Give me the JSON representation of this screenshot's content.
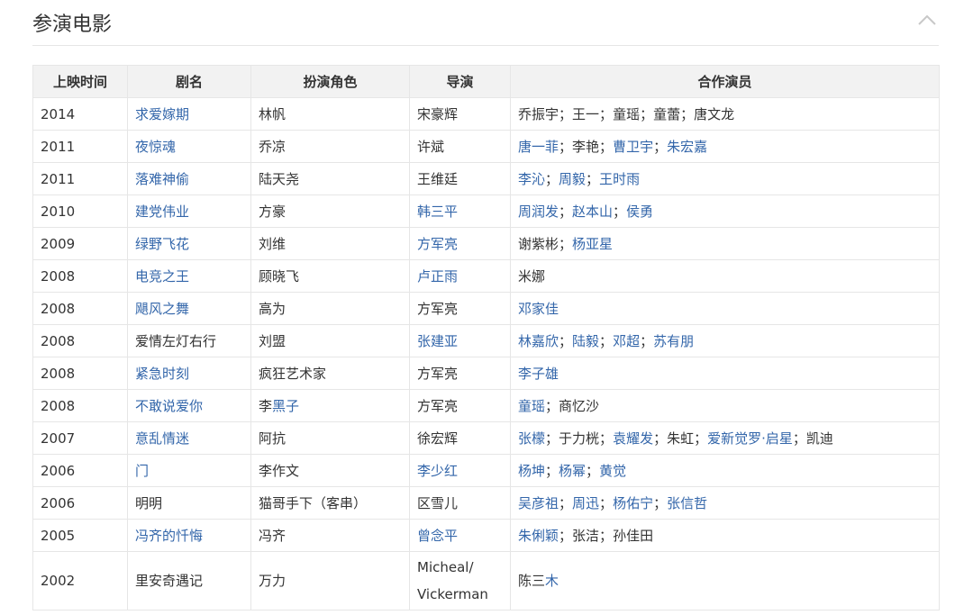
{
  "section": {
    "title": "参演电影",
    "collapse_icon": "chevron-up-icon"
  },
  "colors": {
    "link": "#3366aa",
    "header_bg": "#f2f2f2",
    "border": "#e6e6e6"
  },
  "table": {
    "headers": [
      "上映时间",
      "剧名",
      "扮演角色",
      "导演",
      "合作演员"
    ],
    "rows": [
      {
        "year": "2014",
        "title": {
          "text": "求爱嫁期",
          "link": true
        },
        "role": [
          {
            "text": "林帆",
            "link": false
          }
        ],
        "director": [
          {
            "text": "宋豪辉",
            "link": false
          }
        ],
        "costars": [
          {
            "text": "乔振宇",
            "link": false
          },
          {
            "text": "王一",
            "link": false
          },
          {
            "text": "童瑶",
            "link": false
          },
          {
            "text": "童蕾",
            "link": false
          },
          {
            "text": "唐文龙",
            "link": false
          }
        ]
      },
      {
        "year": "2011",
        "title": {
          "text": "夜惊魂",
          "link": true
        },
        "role": [
          {
            "text": "乔凉",
            "link": false
          }
        ],
        "director": [
          {
            "text": "许斌",
            "link": false
          }
        ],
        "costars": [
          {
            "text": "唐一菲",
            "link": true
          },
          {
            "text": "李艳",
            "link": false
          },
          {
            "text": "曹卫宇",
            "link": true
          },
          {
            "text": "朱宏嘉",
            "link": true
          }
        ]
      },
      {
        "year": "2011",
        "title": {
          "text": "落难神偷",
          "link": true
        },
        "role": [
          {
            "text": "陆天尧",
            "link": false
          }
        ],
        "director": [
          {
            "text": "王维廷",
            "link": false
          }
        ],
        "costars": [
          {
            "text": "李沁",
            "link": true
          },
          {
            "text": "周毅",
            "link": true
          },
          {
            "text": "王时雨",
            "link": true
          }
        ]
      },
      {
        "year": "2010",
        "title": {
          "text": "建党伟业",
          "link": true
        },
        "role": [
          {
            "text": "方豪",
            "link": false
          }
        ],
        "director": [
          {
            "text": "韩三平",
            "link": true
          }
        ],
        "costars": [
          {
            "text": "周润发",
            "link": true
          },
          {
            "text": "赵本山",
            "link": true
          },
          {
            "text": "侯勇",
            "link": true
          }
        ]
      },
      {
        "year": "2009",
        "title": {
          "text": "绿野飞花",
          "link": true
        },
        "role": [
          {
            "text": "刘维",
            "link": false
          }
        ],
        "director": [
          {
            "text": "方军亮",
            "link": true
          }
        ],
        "costars": [
          {
            "text": "谢紫彬",
            "link": false
          },
          {
            "text": "杨亚星",
            "link": true
          }
        ]
      },
      {
        "year": "2008",
        "title": {
          "text": "电竞之王",
          "link": true
        },
        "role": [
          {
            "text": "顾晓飞",
            "link": false
          }
        ],
        "director": [
          {
            "text": "卢正雨",
            "link": true
          }
        ],
        "costars": [
          {
            "text": "米娜",
            "link": false
          }
        ]
      },
      {
        "year": "2008",
        "title": {
          "text": "飓风之舞",
          "link": true
        },
        "role": [
          {
            "text": "高为",
            "link": false
          }
        ],
        "director": [
          {
            "text": "方军亮",
            "link": false
          }
        ],
        "costars": [
          {
            "text": "邓家佳",
            "link": true
          }
        ]
      },
      {
        "year": "2008",
        "title": {
          "text": "爱情左灯右行",
          "link": false
        },
        "role": [
          {
            "text": "刘盟",
            "link": false
          }
        ],
        "director": [
          {
            "text": "张建亚",
            "link": true
          }
        ],
        "costars": [
          {
            "text": "林嘉欣",
            "link": true
          },
          {
            "text": "陆毅",
            "link": true
          },
          {
            "text": "邓超",
            "link": true
          },
          {
            "text": "苏有朋",
            "link": true
          }
        ]
      },
      {
        "year": "2008",
        "title": {
          "text": "紧急时刻",
          "link": true
        },
        "role": [
          {
            "text": "疯狂艺术家",
            "link": false
          }
        ],
        "director": [
          {
            "text": "方军亮",
            "link": false
          }
        ],
        "costars": [
          {
            "text": "李子雄",
            "link": true
          }
        ]
      },
      {
        "year": "2008",
        "title": {
          "text": "不敢说爱你",
          "link": true
        },
        "role": [
          {
            "text": "李",
            "link": false
          },
          {
            "text": "黑子",
            "link": true
          }
        ],
        "director": [
          {
            "text": "方军亮",
            "link": false
          }
        ],
        "costars": [
          {
            "text": "童瑶",
            "link": true
          },
          {
            "text": "商忆沙",
            "link": false
          }
        ]
      },
      {
        "year": "2007",
        "title": {
          "text": "意乱情迷",
          "link": true
        },
        "role": [
          {
            "text": "阿抗",
            "link": false
          }
        ],
        "director": [
          {
            "text": "徐宏辉",
            "link": false
          }
        ],
        "costars": [
          {
            "text": "张檬",
            "link": true
          },
          {
            "text": "于力桄",
            "link": false
          },
          {
            "text": "袁耀发",
            "link": true
          },
          {
            "text": "朱虹",
            "link": false
          },
          {
            "text": "爱新觉罗·启星",
            "link": true
          },
          {
            "text": "凯迪",
            "link": false
          }
        ]
      },
      {
        "year": "2006",
        "title": {
          "text": "门",
          "link": true
        },
        "role": [
          {
            "text": "李作文",
            "link": false
          }
        ],
        "director": [
          {
            "text": "李少红",
            "link": true
          }
        ],
        "costars": [
          {
            "text": "杨坤",
            "link": true
          },
          {
            "text": "杨幂",
            "link": true
          },
          {
            "text": "黄觉",
            "link": true
          }
        ]
      },
      {
        "year": "2006",
        "title": {
          "text": "明明",
          "link": false
        },
        "role": [
          {
            "text": "猫哥手下（客串）",
            "link": false
          }
        ],
        "director": [
          {
            "text": "区雪儿",
            "link": false
          }
        ],
        "costars": [
          {
            "text": "吴彦祖",
            "link": true
          },
          {
            "text": "周迅",
            "link": true
          },
          {
            "text": "杨佑宁",
            "link": true
          },
          {
            "text": "张信哲",
            "link": true
          }
        ]
      },
      {
        "year": "2005",
        "title": {
          "text": "冯齐的忏悔",
          "link": true
        },
        "role": [
          {
            "text": "冯齐",
            "link": false
          }
        ],
        "director": [
          {
            "text": "曾念平",
            "link": true
          }
        ],
        "costars": [
          {
            "text": "朱俐颖",
            "link": true
          },
          {
            "text": "张洁",
            "link": false
          },
          {
            "text": "孙佳田",
            "link": false
          }
        ]
      },
      {
        "year": "2002",
        "title": {
          "text": "里安奇遇记",
          "link": false
        },
        "role": [
          {
            "text": "万力",
            "link": false
          }
        ],
        "director": [
          {
            "text": "Micheal/ Vickerman",
            "link": false
          }
        ],
        "costars": [
          {
            "text": "陈三",
            "link": false
          },
          {
            "text": "木",
            "link": true
          }
        ],
        "costars_joined": true,
        "tall": true
      }
    ]
  }
}
